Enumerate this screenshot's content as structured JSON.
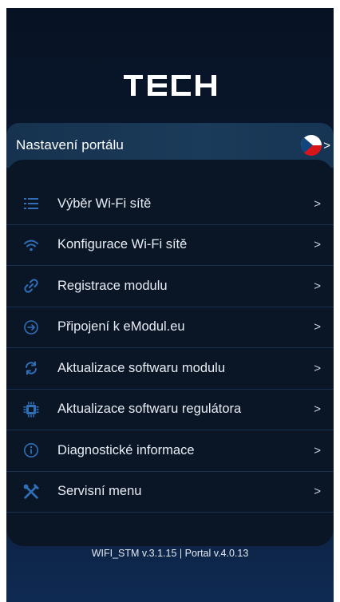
{
  "app": {
    "logo_text": "TECH"
  },
  "portal": {
    "title": "Nastavení portálu",
    "language_flag_icon": "czech-flag-icon",
    "chevron": ">"
  },
  "menu": {
    "items": [
      {
        "label": "Výběr Wi-Fi sítě",
        "icon": "list-icon"
      },
      {
        "label": "Konfigurace Wi-Fi sítě",
        "icon": "wifi-icon"
      },
      {
        "label": "Registrace modulu",
        "icon": "link-icon"
      },
      {
        "label": "Připojení k eModul.eu",
        "icon": "arrow-circle-icon"
      },
      {
        "label": "Aktualizace softwaru modulu",
        "icon": "refresh-icon"
      },
      {
        "label": "Aktualizace softwaru regulátora",
        "icon": "chip-icon"
      },
      {
        "label": "Diagnostické informace",
        "icon": "info-icon"
      },
      {
        "label": "Servisní menu",
        "icon": "tools-icon"
      }
    ],
    "chevron": ">"
  },
  "footer": {
    "version": "WIFI_STM v.3.1.15 | Portal v.4.0.13"
  },
  "colors": {
    "accent": "#2f6fb8",
    "background": "#0a1525"
  }
}
